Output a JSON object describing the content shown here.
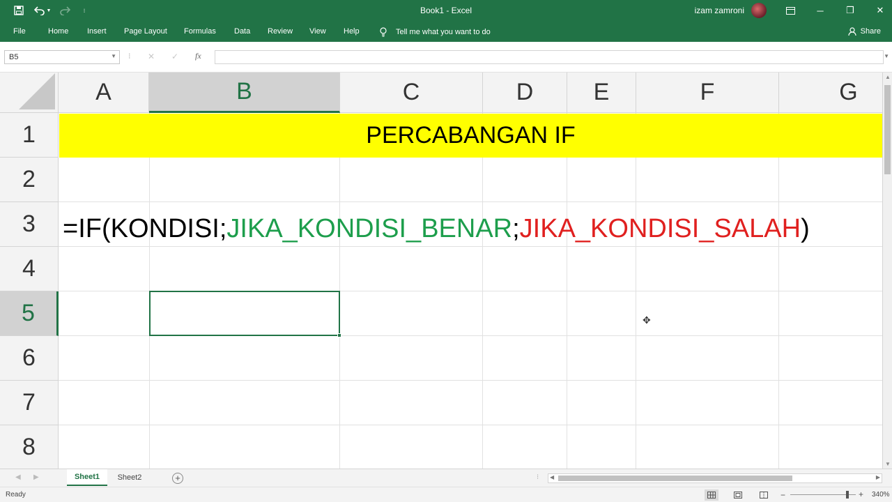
{
  "app": {
    "title": "Book1 - Excel",
    "user": "izam zamroni"
  },
  "quick_access": {
    "save_icon": "save-icon",
    "undo_icon": "undo-icon",
    "redo_icon": "redo-icon",
    "customize_icon": "customize-icon"
  },
  "window": {
    "ribbon_display_icon": "ribbon-display-icon",
    "minimize": "─",
    "restore": "❐",
    "close": "✕"
  },
  "ribbon": {
    "tabs": [
      "File",
      "Home",
      "Insert",
      "Page Layout",
      "Formulas",
      "Data",
      "Review",
      "View",
      "Help"
    ],
    "tell_me": "Tell me what you want to do",
    "share": "Share"
  },
  "formula_bar": {
    "name_box": "B5",
    "cancel": "✕",
    "enter": "✓",
    "fx": "fx",
    "value": ""
  },
  "grid": {
    "columns": [
      "A",
      "B",
      "C",
      "D",
      "E",
      "F",
      "G"
    ],
    "rows": [
      "1",
      "2",
      "3",
      "4",
      "5",
      "6",
      "7",
      "8"
    ],
    "selected_column": "B",
    "selected_row": "5",
    "cells": {
      "row1_title": "PERCABANGAN IF",
      "row3_part1": "=IF(KONDISI;",
      "row3_part2": "JIKA_KONDISI_BENAR",
      "row3_part3": ";",
      "row3_part4": "JIKA_KONDISI_SALAH",
      "row3_part5": ")"
    },
    "colors": {
      "title_fill": "#ffff00",
      "true_text": "#1d9e4c",
      "false_text": "#e0201f",
      "accent": "#217346"
    }
  },
  "sheets": {
    "tabs": [
      "Sheet1",
      "Sheet2"
    ],
    "active": "Sheet1",
    "add": "+"
  },
  "status": {
    "text": "Ready",
    "zoom": "340%"
  }
}
